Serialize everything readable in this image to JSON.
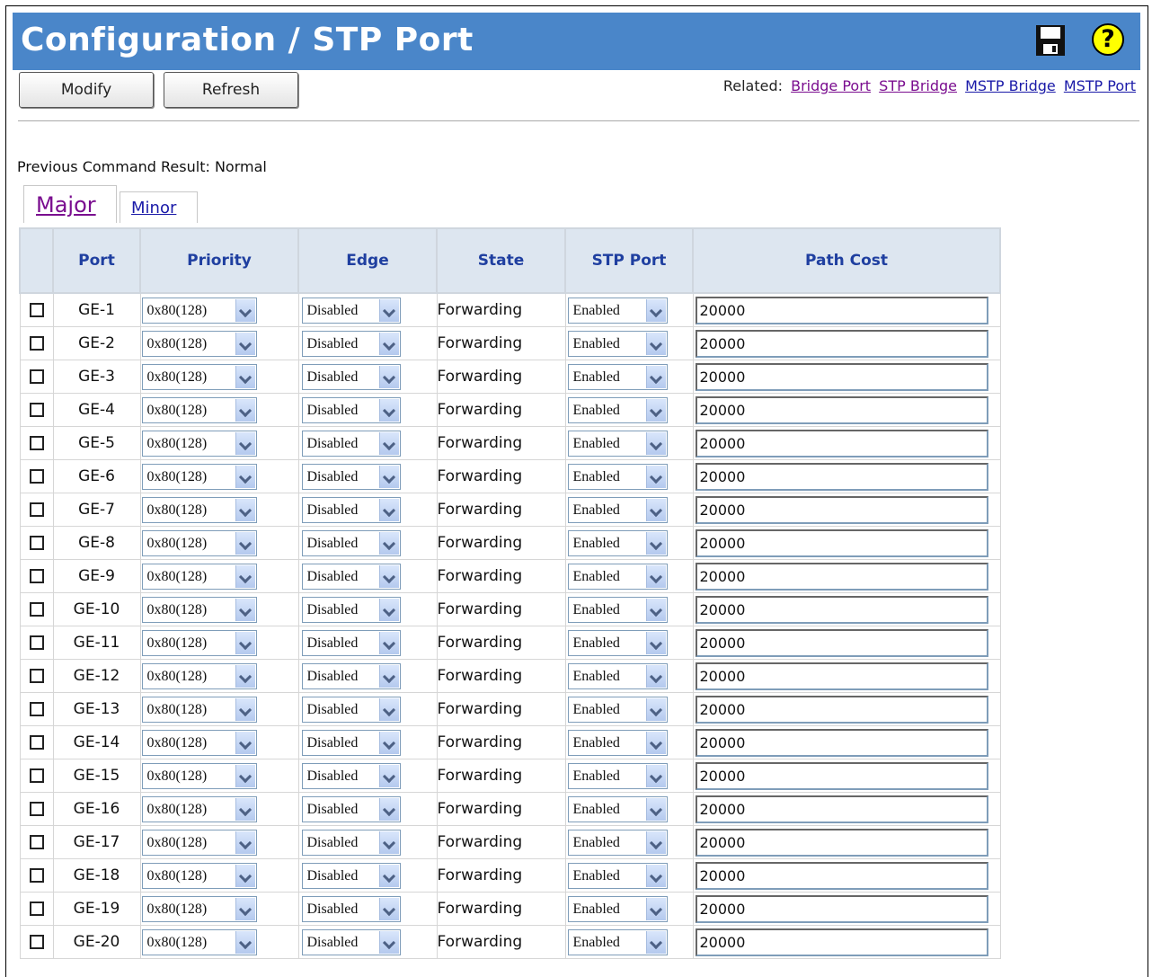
{
  "header": {
    "title": "Configuration / STP Port",
    "save_icon": "save-icon",
    "help_icon": "help-icon",
    "help_glyph": "?"
  },
  "toolbar": {
    "modify_label": "Modify",
    "refresh_label": "Refresh"
  },
  "related": {
    "label": "Related:",
    "links": [
      "Bridge Port",
      "STP Bridge",
      "MSTP Bridge",
      "MSTP Port"
    ]
  },
  "status": {
    "text": "Previous Command Result: Normal"
  },
  "tabs": [
    {
      "label": "Major",
      "active": true
    },
    {
      "label": "Minor",
      "active": false
    }
  ],
  "table": {
    "columns": [
      "",
      "Port",
      "Priority",
      "Edge",
      "State",
      "STP Port",
      "Path Cost"
    ],
    "rows": [
      {
        "port": "GE-1",
        "priority": "0x80(128)",
        "edge": "Disabled",
        "state": "Forwarding",
        "stp_port": "Enabled",
        "path_cost": "20000"
      },
      {
        "port": "GE-2",
        "priority": "0x80(128)",
        "edge": "Disabled",
        "state": "Forwarding",
        "stp_port": "Enabled",
        "path_cost": "20000"
      },
      {
        "port": "GE-3",
        "priority": "0x80(128)",
        "edge": "Disabled",
        "state": "Forwarding",
        "stp_port": "Enabled",
        "path_cost": "20000"
      },
      {
        "port": "GE-4",
        "priority": "0x80(128)",
        "edge": "Disabled",
        "state": "Forwarding",
        "stp_port": "Enabled",
        "path_cost": "20000"
      },
      {
        "port": "GE-5",
        "priority": "0x80(128)",
        "edge": "Disabled",
        "state": "Forwarding",
        "stp_port": "Enabled",
        "path_cost": "20000"
      },
      {
        "port": "GE-6",
        "priority": "0x80(128)",
        "edge": "Disabled",
        "state": "Forwarding",
        "stp_port": "Enabled",
        "path_cost": "20000"
      },
      {
        "port": "GE-7",
        "priority": "0x80(128)",
        "edge": "Disabled",
        "state": "Forwarding",
        "stp_port": "Enabled",
        "path_cost": "20000"
      },
      {
        "port": "GE-8",
        "priority": "0x80(128)",
        "edge": "Disabled",
        "state": "Forwarding",
        "stp_port": "Enabled",
        "path_cost": "20000"
      },
      {
        "port": "GE-9",
        "priority": "0x80(128)",
        "edge": "Disabled",
        "state": "Forwarding",
        "stp_port": "Enabled",
        "path_cost": "20000"
      },
      {
        "port": "GE-10",
        "priority": "0x80(128)",
        "edge": "Disabled",
        "state": "Forwarding",
        "stp_port": "Enabled",
        "path_cost": "20000"
      },
      {
        "port": "GE-11",
        "priority": "0x80(128)",
        "edge": "Disabled",
        "state": "Forwarding",
        "stp_port": "Enabled",
        "path_cost": "20000"
      },
      {
        "port": "GE-12",
        "priority": "0x80(128)",
        "edge": "Disabled",
        "state": "Forwarding",
        "stp_port": "Enabled",
        "path_cost": "20000"
      },
      {
        "port": "GE-13",
        "priority": "0x80(128)",
        "edge": "Disabled",
        "state": "Forwarding",
        "stp_port": "Enabled",
        "path_cost": "20000"
      },
      {
        "port": "GE-14",
        "priority": "0x80(128)",
        "edge": "Disabled",
        "state": "Forwarding",
        "stp_port": "Enabled",
        "path_cost": "20000"
      },
      {
        "port": "GE-15",
        "priority": "0x80(128)",
        "edge": "Disabled",
        "state": "Forwarding",
        "stp_port": "Enabled",
        "path_cost": "20000"
      },
      {
        "port": "GE-16",
        "priority": "0x80(128)",
        "edge": "Disabled",
        "state": "Forwarding",
        "stp_port": "Enabled",
        "path_cost": "20000"
      },
      {
        "port": "GE-17",
        "priority": "0x80(128)",
        "edge": "Disabled",
        "state": "Forwarding",
        "stp_port": "Enabled",
        "path_cost": "20000"
      },
      {
        "port": "GE-18",
        "priority": "0x80(128)",
        "edge": "Disabled",
        "state": "Forwarding",
        "stp_port": "Enabled",
        "path_cost": "20000"
      },
      {
        "port": "GE-19",
        "priority": "0x80(128)",
        "edge": "Disabled",
        "state": "Forwarding",
        "stp_port": "Enabled",
        "path_cost": "20000"
      },
      {
        "port": "GE-20",
        "priority": "0x80(128)",
        "edge": "Disabled",
        "state": "Forwarding",
        "stp_port": "Enabled",
        "path_cost": "20000"
      }
    ]
  },
  "colors": {
    "header_bg": "#4a86c9",
    "column_header_bg": "#dde6f0",
    "column_header_text": "#1f3fa0",
    "visited_link": "#7a0d8f",
    "link": "#1a1aa8"
  }
}
